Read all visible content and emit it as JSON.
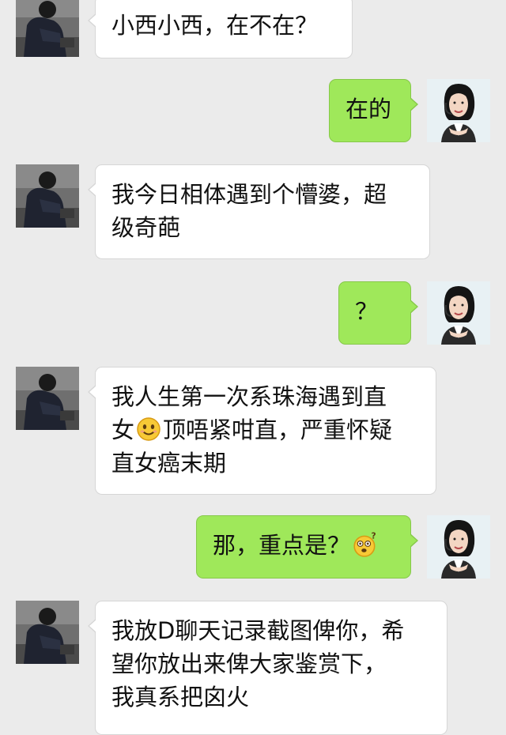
{
  "conversation": {
    "messages": [
      {
        "side": "in",
        "lines": [
          "小西小西，在不在？"
        ]
      },
      {
        "side": "out",
        "lines": [
          "在的"
        ]
      },
      {
        "side": "in",
        "lines": [
          "我今日相体遇到个懵婆，超",
          "级奇葩"
        ]
      },
      {
        "side": "out",
        "lines": [
          "？"
        ]
      },
      {
        "side": "in",
        "line1": "我人生第一次系珠海遇到直",
        "line2_a": "女",
        "line2_b": "顶唔紧咁直，严重怀疑",
        "line3": "直女癌末期",
        "emoji": "smile-emoji"
      },
      {
        "side": "out",
        "text": "那，重点是？",
        "emoji": "confused-emoji"
      },
      {
        "side": "in",
        "lines": [
          "我放D聊天记录截图俾你，希",
          "望你放出来俾大家鉴赏下，",
          "我真系把囟火"
        ]
      }
    ]
  },
  "colors": {
    "background": "#ebebeb",
    "incoming_bubble": "#ffffff",
    "outgoing_bubble": "#9fe85a"
  }
}
